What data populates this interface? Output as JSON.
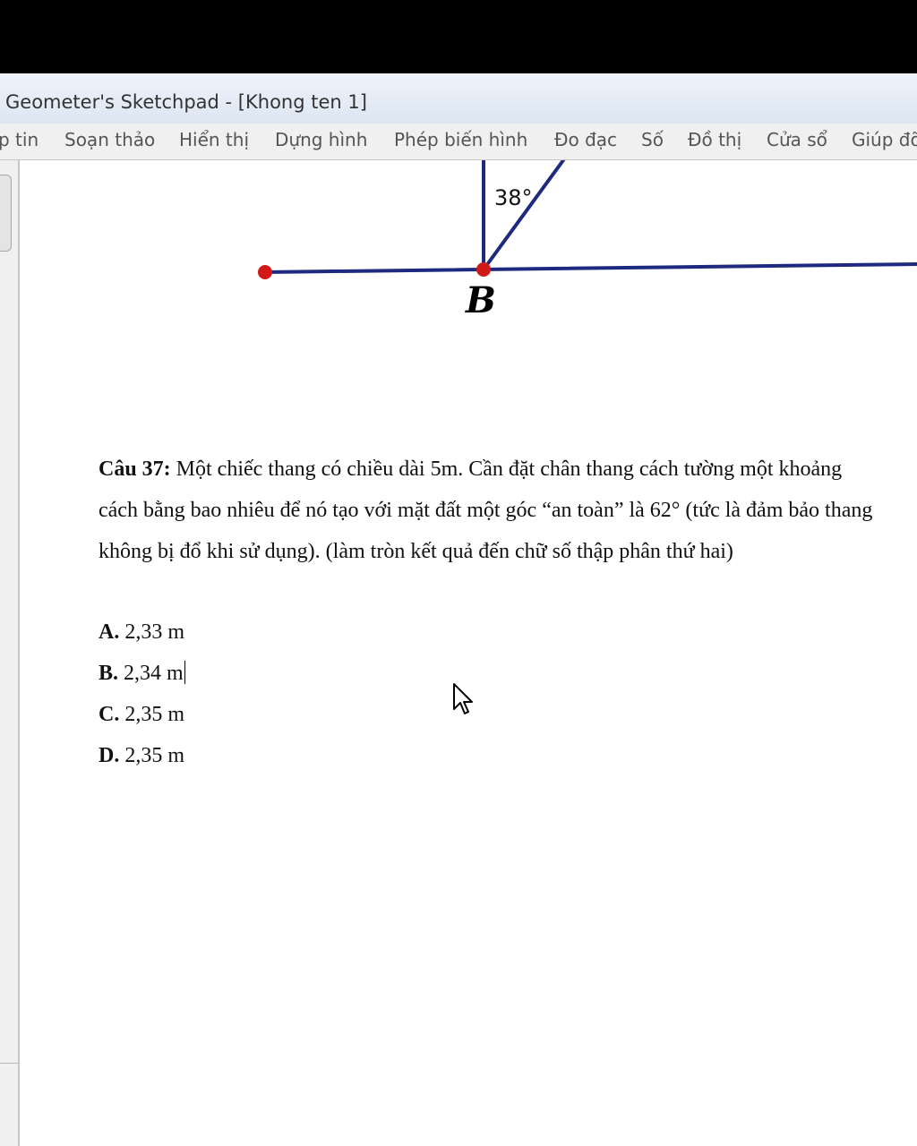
{
  "window": {
    "title": "Geometer's Sketchpad - [Khong ten 1]"
  },
  "menu": {
    "items": [
      "p tin",
      "Soạn thảo",
      "Hiển thị",
      "Dựng hình",
      "Phép biến hình",
      "Đo đạc",
      "Số",
      "Đồ thị",
      "Cửa sổ",
      "Giúp đỡ"
    ]
  },
  "diagram": {
    "point_label": "B",
    "angle_label": "38°",
    "colors": {
      "line": "#1e2a80",
      "point": "#d01a1a"
    }
  },
  "question": {
    "label": "Câu 37:",
    "text": " Một chiếc thang có chiều dài 5m. Cần đặt chân thang cách tường một khoảng cách bằng bao nhiêu để nó tạo với mặt đất một góc “an toàn” là 62° (tức là đảm bảo thang không bị đổ khi sử dụng). (làm tròn kết quả đến chữ số thập phân thứ hai)",
    "answers": [
      {
        "letter": "A.",
        "text": " 2,33 m"
      },
      {
        "letter": "B.",
        "text": " 2,34 m"
      },
      {
        "letter": "C.",
        "text": " 2,35 m"
      },
      {
        "letter": "D.",
        "text": " 2,35 m"
      }
    ]
  }
}
